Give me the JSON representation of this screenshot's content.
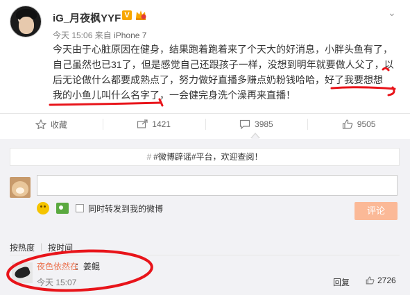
{
  "post": {
    "username": "iG_月夜枫YYF",
    "badge": "V",
    "time": "今天 15:06",
    "source_prefix": "来自",
    "source": "iPhone 7",
    "lines": [
      "今天由于心脏原因在健身，结果跑着跑着来了个天大的好消息，小胖头鱼有了，",
      "自己虽然也已31了，但是感觉自己还跟孩子一样，没想到明年就要做人父了，以",
      "后无论做什么都要成熟点了，努力做好直播多赚点奶粉钱哈哈，好了我要想想",
      "我的小鱼儿叫什么名字了，一会健完身洗个澡再来直播！"
    ]
  },
  "actions": [
    {
      "label": "收藏",
      "icon": "star-icon"
    },
    {
      "label": "1421",
      "icon": "share-icon"
    },
    {
      "label": "3985",
      "icon": "comment-icon"
    },
    {
      "label": "9505",
      "icon": "like-icon"
    }
  ],
  "comments": {
    "notice_hash": "#",
    "notice": "#微博辟谣#平台，欢迎查阅！",
    "sync_label": "同时转发到我的微博",
    "submit_label": "评论",
    "sort_hot": "按热度",
    "sort_sep": "|",
    "sort_time": "按时间",
    "items": [
      {
        "name": "夜色依然在",
        "text": "：姜鲲",
        "time": "今天 15:07",
        "reply": "回复",
        "likes": "2726"
      }
    ]
  },
  "colors": {
    "accent": "#eb7350",
    "annotation": "#e8141a",
    "submit_disabled": "#fbb997"
  }
}
